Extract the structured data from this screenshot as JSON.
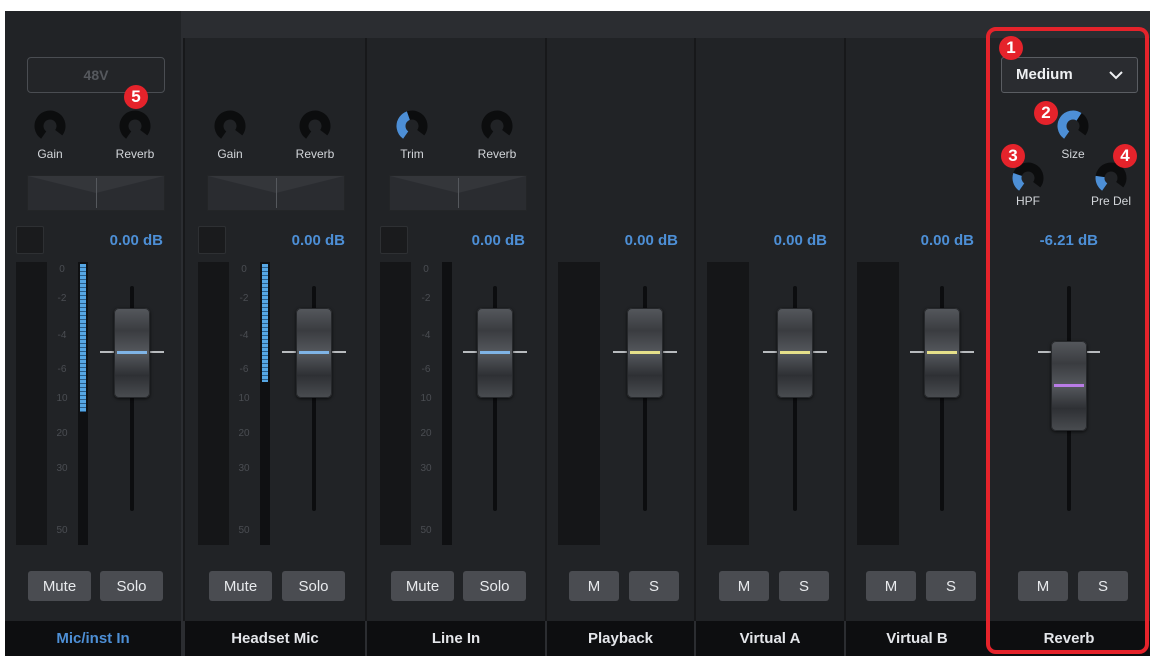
{
  "phantom_power": {
    "label": "48V"
  },
  "channels": [
    {
      "name": "Mic/inst In",
      "selected": true,
      "knob1": "Gain",
      "knob2": "Reverb",
      "level": "0.00 dB",
      "mute": "Mute",
      "solo": "Solo"
    },
    {
      "name": "Headset Mic",
      "knob1": "Gain",
      "knob2": "Reverb",
      "level": "0.00 dB",
      "mute": "Mute",
      "solo": "Solo"
    },
    {
      "name": "Line In",
      "knob1": "Trim",
      "knob2": "Reverb",
      "level": "0.00 dB",
      "mute": "Mute",
      "solo": "Solo"
    },
    {
      "name": "Playback",
      "level": "0.00 dB",
      "mute": "M",
      "solo": "S"
    },
    {
      "name": "Virtual A",
      "level": "0.00 dB",
      "mute": "M",
      "solo": "S"
    },
    {
      "name": "Virtual B",
      "level": "0.00 dB",
      "mute": "M",
      "solo": "S"
    },
    {
      "name": "Reverb",
      "level": "-6.21 dB",
      "mute": "M",
      "solo": "S"
    }
  ],
  "meter_scale": [
    "0",
    "-2",
    "-4",
    "-6",
    "10",
    "20",
    "30",
    "50"
  ],
  "reverb": {
    "type_selected": "Medium",
    "size_label": "Size",
    "hpf_label": "HPF",
    "predelay_label": "Pre Del"
  },
  "callouts": [
    "1",
    "2",
    "3",
    "4",
    "5"
  ],
  "colors": {
    "accent_blue": "#4d8fd6",
    "callout_red": "#e5232b",
    "fader_blue": "#7fb4e6",
    "fader_yellow": "#e6e08a",
    "fader_purple": "#b97ce6"
  }
}
